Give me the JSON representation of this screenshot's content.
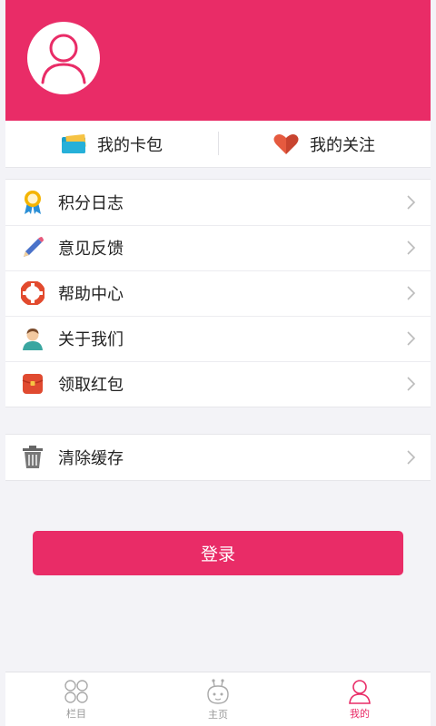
{
  "colors": {
    "accent": "#e92c67",
    "background": "#f3f3f7",
    "text": "#222222",
    "muted": "#999999"
  },
  "header": {
    "avatar_icon": "user-avatar-icon"
  },
  "quick": {
    "card": {
      "label": "我的卡包",
      "icon": "card-wallet-icon"
    },
    "follow": {
      "label": "我的关注",
      "icon": "heart-icon"
    }
  },
  "menu": [
    {
      "label": "积分日志",
      "icon": "award-ribbon-icon"
    },
    {
      "label": "意见反馈",
      "icon": "pencil-icon"
    },
    {
      "label": "帮助中心",
      "icon": "lifebuoy-icon"
    },
    {
      "label": "关于我们",
      "icon": "person-icon"
    },
    {
      "label": "领取红包",
      "icon": "red-envelope-icon"
    }
  ],
  "menu2": [
    {
      "label": "清除缓存",
      "icon": "trash-icon"
    }
  ],
  "login": {
    "label": "登录"
  },
  "tabs": [
    {
      "label": "栏目",
      "icon": "grid-circles-icon",
      "active": false
    },
    {
      "label": "主页",
      "icon": "robot-face-icon",
      "active": false
    },
    {
      "label": "我的",
      "icon": "user-icon",
      "active": true
    }
  ]
}
